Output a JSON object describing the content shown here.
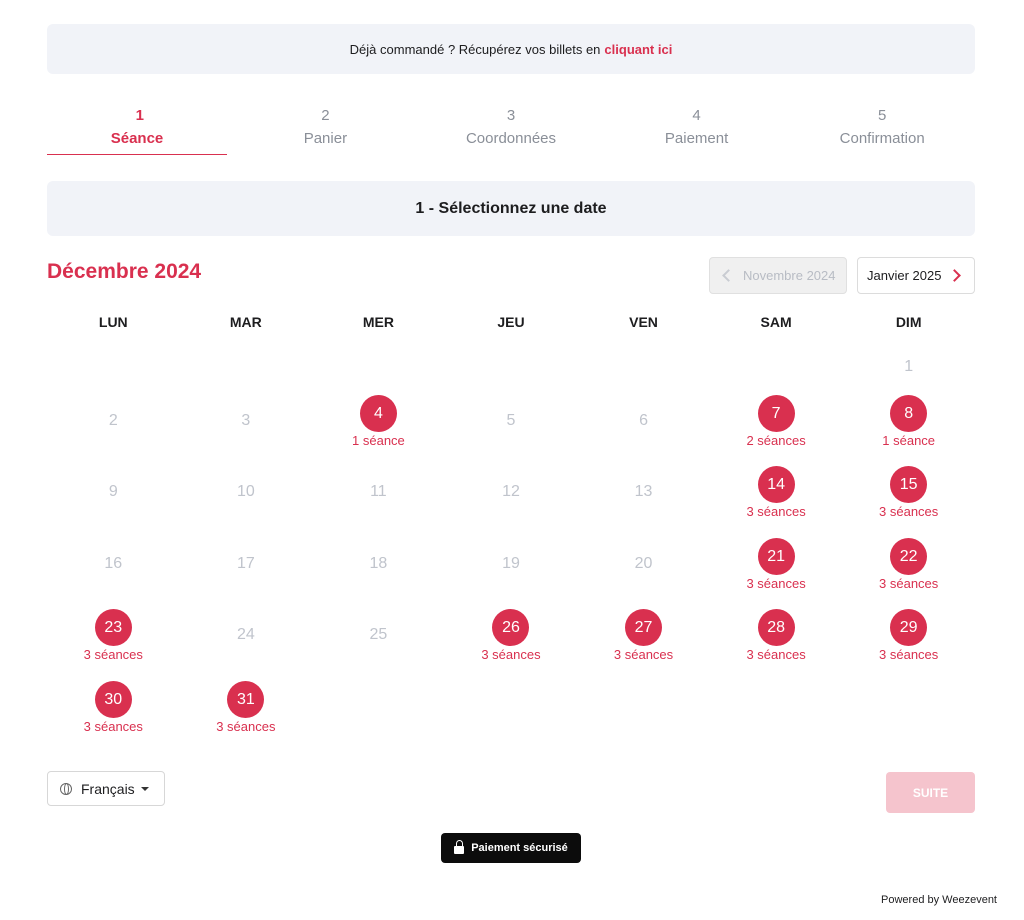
{
  "banner": {
    "text": "Déjà commandé ? Récupérez vos billets en",
    "link": "cliquant ici"
  },
  "steps": [
    {
      "num": "1",
      "label": "Séance",
      "active": true
    },
    {
      "num": "2",
      "label": "Panier",
      "active": false
    },
    {
      "num": "3",
      "label": "Coordonnées",
      "active": false
    },
    {
      "num": "4",
      "label": "Paiement",
      "active": false
    },
    {
      "num": "5",
      "label": "Confirmation",
      "active": false
    }
  ],
  "section_title": "1 - Sélectionnez une date",
  "calendar": {
    "month": "Décembre 2024",
    "prev_month": "Novembre 2024",
    "next_month": "Janvier 2025",
    "weekdays": [
      "LUN",
      "MAR",
      "MER",
      "JEU",
      "VEN",
      "SAM",
      "DIM"
    ],
    "weeks": [
      [
        null,
        null,
        null,
        null,
        null,
        null,
        {
          "day": "1"
        }
      ],
      [
        {
          "day": "2"
        },
        {
          "day": "3"
        },
        {
          "day": "4",
          "sessions": "1 séance"
        },
        {
          "day": "5"
        },
        {
          "day": "6"
        },
        {
          "day": "7",
          "sessions": "2 séances"
        },
        {
          "day": "8",
          "sessions": "1 séance"
        }
      ],
      [
        {
          "day": "9"
        },
        {
          "day": "10"
        },
        {
          "day": "11"
        },
        {
          "day": "12"
        },
        {
          "day": "13"
        },
        {
          "day": "14",
          "sessions": "3 séances"
        },
        {
          "day": "15",
          "sessions": "3 séances"
        }
      ],
      [
        {
          "day": "16"
        },
        {
          "day": "17"
        },
        {
          "day": "18"
        },
        {
          "day": "19"
        },
        {
          "day": "20"
        },
        {
          "day": "21",
          "sessions": "3 séances"
        },
        {
          "day": "22",
          "sessions": "3 séances"
        }
      ],
      [
        {
          "day": "23",
          "sessions": "3 séances"
        },
        {
          "day": "24"
        },
        {
          "day": "25"
        },
        {
          "day": "26",
          "sessions": "3 séances"
        },
        {
          "day": "27",
          "sessions": "3 séances"
        },
        {
          "day": "28",
          "sessions": "3 séances"
        },
        {
          "day": "29",
          "sessions": "3 séances"
        }
      ],
      [
        {
          "day": "30",
          "sessions": "3 séances"
        },
        {
          "day": "31",
          "sessions": "3 séances"
        },
        null,
        null,
        null,
        null,
        null
      ]
    ]
  },
  "language": "Français",
  "next_label": "SUITE",
  "secure_label": "Paiement sécurisé",
  "powered_by": "Powered by Weezevent",
  "colors": {
    "accent": "#d9304f",
    "panel": "#f1f3f8",
    "disabled_accent": "#f5c4cd"
  }
}
